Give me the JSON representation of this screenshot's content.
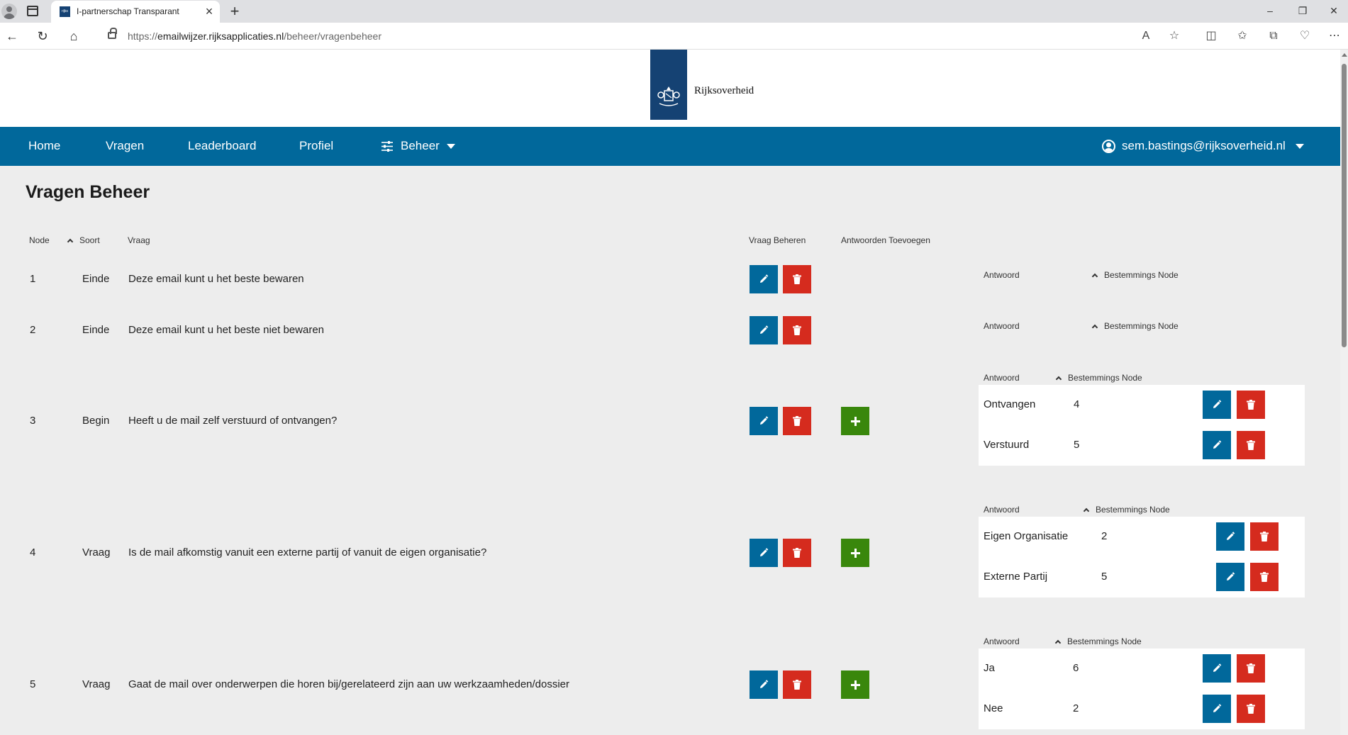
{
  "browser": {
    "tab_title": "I-partnerschap Transparant",
    "favicon_text": "rijks",
    "url_prefix": "https://",
    "url_domain": "emailwijzer.rijksapplicaties.nl",
    "url_path": "/beheer/vragenbeheer",
    "new_tab": "+",
    "close_tab": "×",
    "minimize": "–",
    "restore": "❐",
    "close_window": "✕"
  },
  "header": {
    "logo_text": "Rijksoverheid"
  },
  "nav": {
    "home": "Home",
    "vragen": "Vragen",
    "leaderboard": "Leaderboard",
    "profiel": "Profiel",
    "beheer": "Beheer",
    "user": "sem.bastings@rijksoverheid.nl"
  },
  "colors": {
    "nav_blue": "#01689b",
    "edit_blue": "#01689b",
    "delete_red": "#d52b1e",
    "add_green": "#39870c",
    "logo_blue": "#154273"
  },
  "page": {
    "title": "Vragen Beheer"
  },
  "table": {
    "headers": {
      "node": "Node",
      "soort": "Soort",
      "vraag": "Vraag",
      "vraag_beheren": "Vraag Beheren",
      "antwoorden_toevoegen": "Antwoorden Toevoegen"
    },
    "answer_headers": {
      "antwoord": "Antwoord",
      "bestemmings_node": "Bestemmings Node"
    },
    "rows": [
      {
        "node": "1",
        "soort": "Einde",
        "vraag": "Deze email kunt u het beste bewaren",
        "answers": []
      },
      {
        "node": "2",
        "soort": "Einde",
        "vraag": "Deze email kunt u het beste niet bewaren",
        "answers": []
      },
      {
        "node": "3",
        "soort": "Begin",
        "vraag": "Heeft u de mail zelf verstuurd of ontvangen?",
        "answers": [
          {
            "antwoord": "Ontvangen",
            "bestemming": "4"
          },
          {
            "antwoord": "Verstuurd",
            "bestemming": "5"
          }
        ]
      },
      {
        "node": "4",
        "soort": "Vraag",
        "vraag": "Is de mail afkomstig vanuit een externe partij of vanuit de eigen organisatie?",
        "answers": [
          {
            "antwoord": "Eigen Organisatie",
            "bestemming": "2"
          },
          {
            "antwoord": "Externe Partij",
            "bestemming": "5"
          }
        ]
      },
      {
        "node": "5",
        "soort": "Vraag",
        "vraag": "Gaat de mail over onderwerpen die horen bij/gerelateerd zijn aan uw werkzaamheden/dossier",
        "answers": [
          {
            "antwoord": "Ja",
            "bestemming": "6"
          },
          {
            "antwoord": "Nee",
            "bestemming": "2"
          }
        ]
      }
    ]
  }
}
